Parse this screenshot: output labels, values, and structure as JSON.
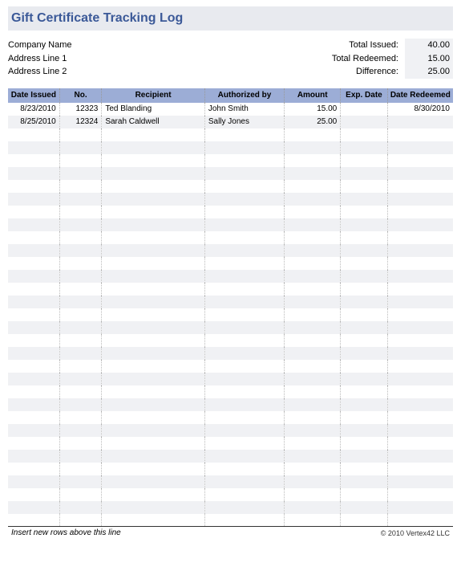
{
  "title": "Gift Certificate Tracking Log",
  "company": {
    "name": "Company Name",
    "address1": "Address Line 1",
    "address2": "Address Line 2"
  },
  "totals": {
    "issued_label": "Total Issued:",
    "issued_value": "40.00",
    "redeemed_label": "Total Redeemed:",
    "redeemed_value": "15.00",
    "difference_label": "Difference:",
    "difference_value": "25.00"
  },
  "columns": {
    "date_issued": "Date Issued",
    "no": "No.",
    "recipient": "Recipient",
    "authorized_by": "Authorized by",
    "amount": "Amount",
    "exp_date": "Exp. Date",
    "date_redeemed": "Date Redeemed"
  },
  "rows": [
    {
      "date_issued": "8/23/2010",
      "no": "12323",
      "recipient": "Ted Blanding",
      "authorized_by": "John Smith",
      "amount": "15.00",
      "exp_date": "",
      "date_redeemed": "8/30/2010"
    },
    {
      "date_issued": "8/25/2010",
      "no": "12324",
      "recipient": "Sarah Caldwell",
      "authorized_by": "Sally Jones",
      "amount": "25.00",
      "exp_date": "",
      "date_redeemed": ""
    }
  ],
  "empty_row_count": 31,
  "footer_note": "Insert new rows above this line",
  "copyright": "© 2010 Vertex42 LLC"
}
